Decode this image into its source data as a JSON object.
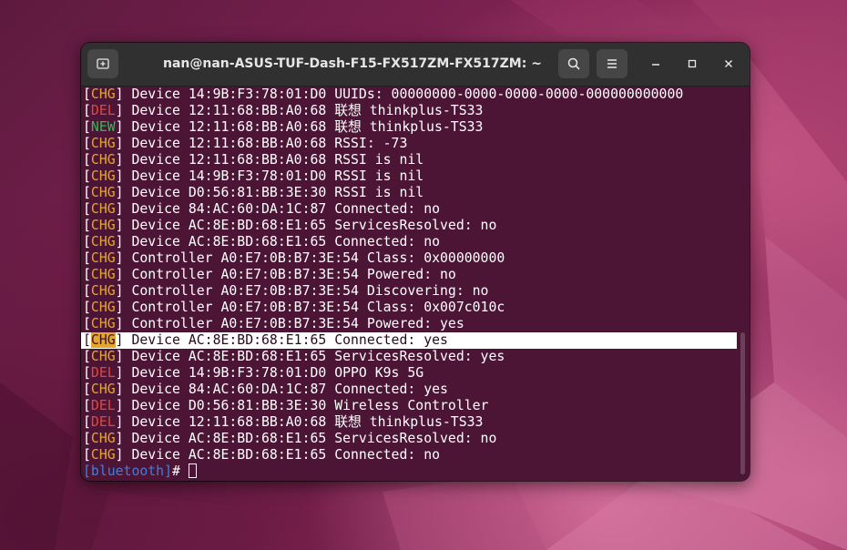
{
  "window": {
    "title": "nan@nan-ASUS-TUF-Dash-F15-FX517ZM-FX517ZM: ~"
  },
  "icons": {
    "new_tab": "new-tab-icon",
    "search": "search-icon",
    "menu": "hamburger-menu-icon",
    "minimize": "minimize-icon",
    "maximize": "maximize-icon",
    "close": "close-icon"
  },
  "colors": {
    "chg": "#e4a62b",
    "del": "#e0483e",
    "new": "#2bbf4e",
    "prompt": "#3d7fe0",
    "terminal_bg": "#4c1536"
  },
  "terminal": {
    "lines": [
      {
        "tag": "CHG",
        "text": " Device 14:9B:F3:78:01:D0 UUIDs: 00000000-0000-0000-0000-000000000000"
      },
      {
        "tag": "DEL",
        "text": " Device 12:11:68:BB:A0:68 联想 thinkplus-TS33"
      },
      {
        "tag": "NEW",
        "text": " Device 12:11:68:BB:A0:68 联想 thinkplus-TS33"
      },
      {
        "tag": "CHG",
        "text": " Device 12:11:68:BB:A0:68 RSSI: -73"
      },
      {
        "tag": "CHG",
        "text": " Device 12:11:68:BB:A0:68 RSSI is nil"
      },
      {
        "tag": "CHG",
        "text": " Device 14:9B:F3:78:01:D0 RSSI is nil"
      },
      {
        "tag": "CHG",
        "text": " Device D0:56:81:BB:3E:30 RSSI is nil"
      },
      {
        "tag": "CHG",
        "text": " Device 84:AC:60:DA:1C:87 Connected: no"
      },
      {
        "tag": "CHG",
        "text": " Device AC:8E:BD:68:E1:65 ServicesResolved: no"
      },
      {
        "tag": "CHG",
        "text": " Device AC:8E:BD:68:E1:65 Connected: no"
      },
      {
        "tag": "CHG",
        "text": " Controller A0:E7:0B:B7:3E:54 Class: 0x00000000"
      },
      {
        "tag": "CHG",
        "text": " Controller A0:E7:0B:B7:3E:54 Powered: no"
      },
      {
        "tag": "CHG",
        "text": " Controller A0:E7:0B:B7:3E:54 Discovering: no"
      },
      {
        "tag": "CHG",
        "text": " Controller A0:E7:0B:B7:3E:54 Class: 0x007c010c"
      },
      {
        "tag": "CHG",
        "text": " Controller A0:E7:0B:B7:3E:54 Powered: yes"
      },
      {
        "tag": "CHG",
        "text": " Device AC:8E:BD:68:E1:65 Connected: yes",
        "highlighted": true
      },
      {
        "tag": "CHG",
        "text": " Device AC:8E:BD:68:E1:65 ServicesResolved: yes"
      },
      {
        "tag": "DEL",
        "text": " Device 14:9B:F3:78:01:D0 OPPO K9s 5G"
      },
      {
        "tag": "CHG",
        "text": " Device 84:AC:60:DA:1C:87 Connected: yes"
      },
      {
        "tag": "DEL",
        "text": " Device D0:56:81:BB:3E:30 Wireless Controller"
      },
      {
        "tag": "DEL",
        "text": " Device 12:11:68:BB:A0:68 联想 thinkplus-TS33"
      },
      {
        "tag": "CHG",
        "text": " Device AC:8E:BD:68:E1:65 ServicesResolved: no"
      },
      {
        "tag": "CHG",
        "text": " Device AC:8E:BD:68:E1:65 Connected: no"
      }
    ],
    "prompt": "[bluetooth]",
    "prompt_suffix": "# "
  }
}
